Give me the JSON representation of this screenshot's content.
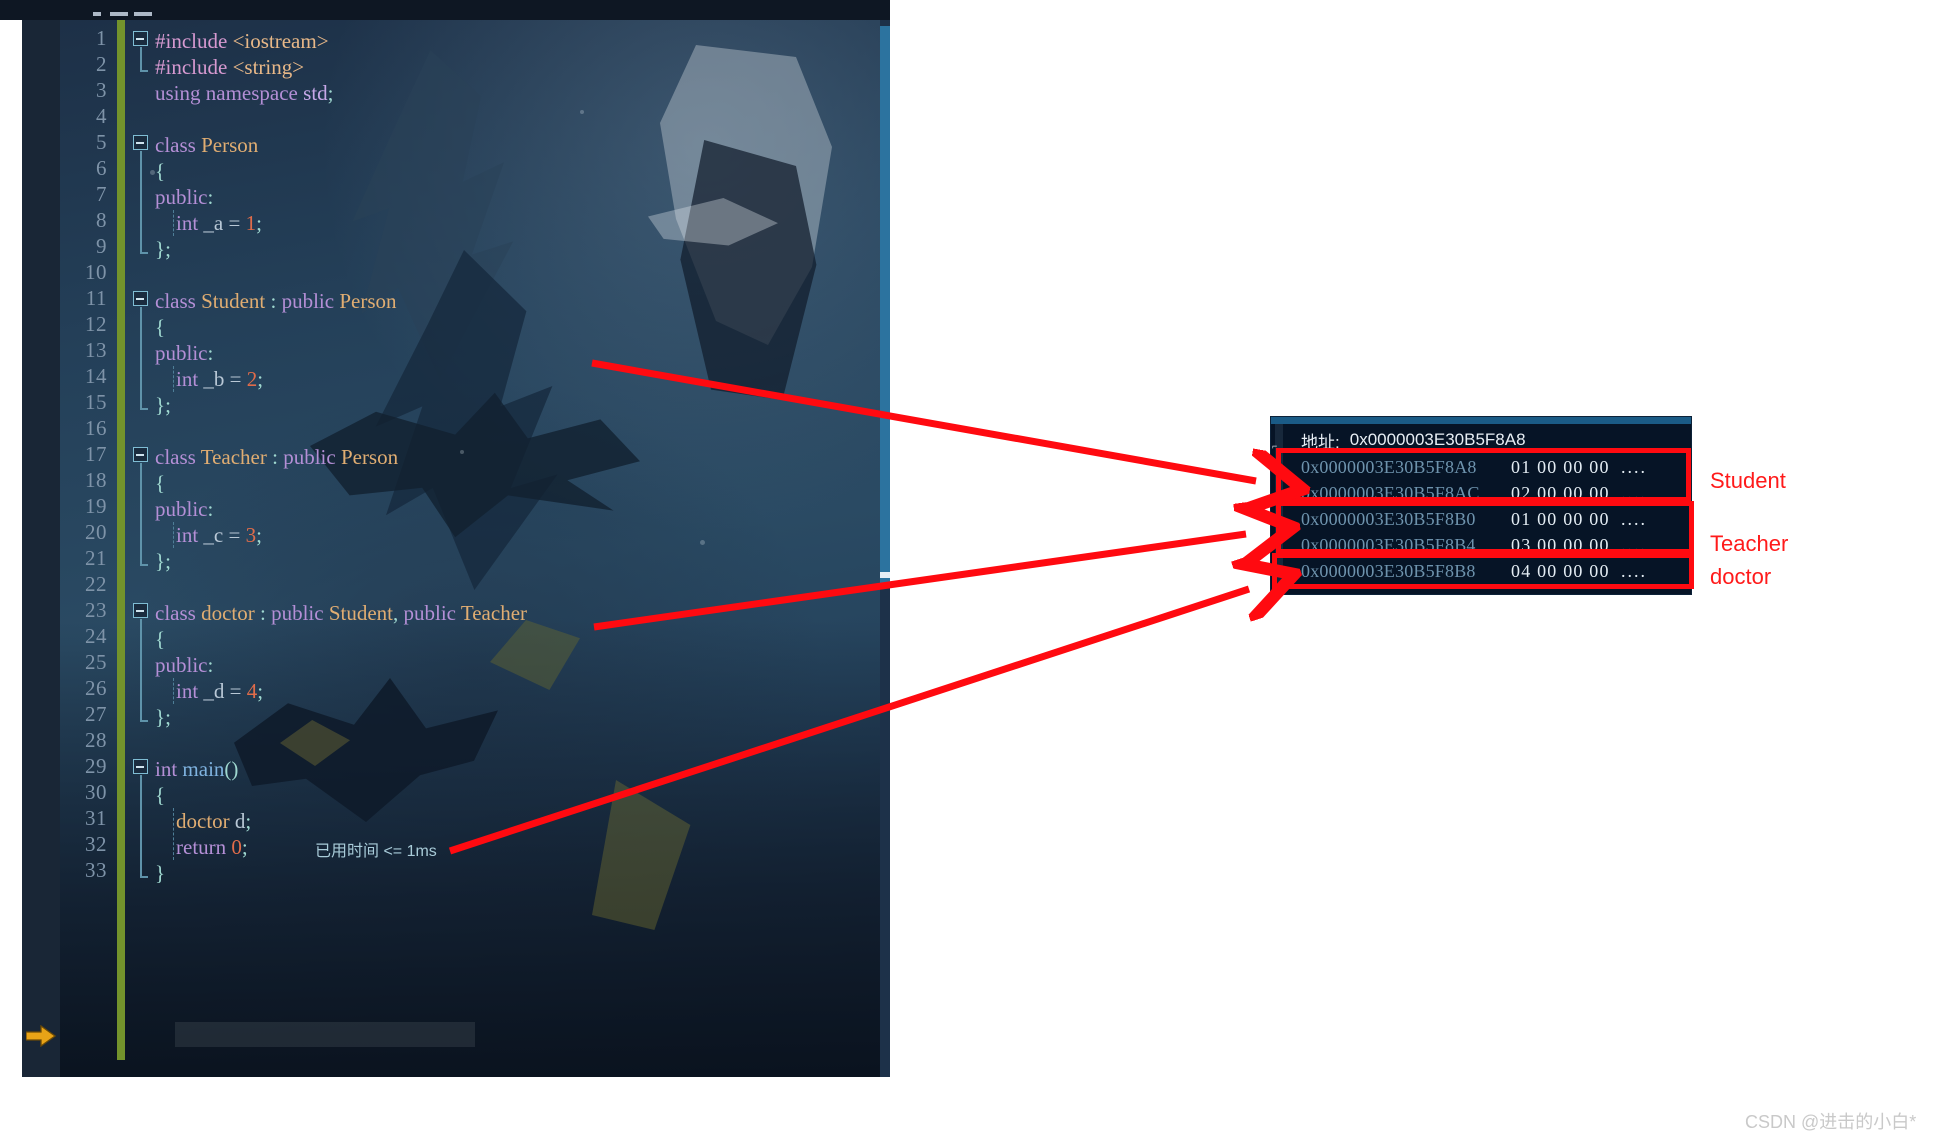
{
  "editor": {
    "changes_bar_color": "#73932c",
    "lines": [
      {
        "n": "1",
        "text": "#include <iostream>"
      },
      {
        "n": "2",
        "text": "#include <string>"
      },
      {
        "n": "3",
        "text": "using namespace std;"
      },
      {
        "n": "4",
        "text": ""
      },
      {
        "n": "5",
        "text": "class Person"
      },
      {
        "n": "6",
        "text": "{"
      },
      {
        "n": "7",
        "text": "public:"
      },
      {
        "n": "8",
        "text": "    int _a = 1;"
      },
      {
        "n": "9",
        "text": "};"
      },
      {
        "n": "10",
        "text": ""
      },
      {
        "n": "11",
        "text": "class Student : public Person"
      },
      {
        "n": "12",
        "text": "{"
      },
      {
        "n": "13",
        "text": "public:"
      },
      {
        "n": "14",
        "text": "    int _b = 2;"
      },
      {
        "n": "15",
        "text": "};"
      },
      {
        "n": "16",
        "text": ""
      },
      {
        "n": "17",
        "text": "class Teacher : public Person"
      },
      {
        "n": "18",
        "text": "{"
      },
      {
        "n": "19",
        "text": "public:"
      },
      {
        "n": "20",
        "text": "    int _c = 3;"
      },
      {
        "n": "21",
        "text": "};"
      },
      {
        "n": "22",
        "text": ""
      },
      {
        "n": "23",
        "text": "class doctor : public Student, public Teacher"
      },
      {
        "n": "24",
        "text": "{"
      },
      {
        "n": "25",
        "text": "public:"
      },
      {
        "n": "26",
        "text": "    int _d = 4;"
      },
      {
        "n": "27",
        "text": "};"
      },
      {
        "n": "28",
        "text": ""
      },
      {
        "n": "29",
        "text": "int main()"
      },
      {
        "n": "30",
        "text": "{"
      },
      {
        "n": "31",
        "text": "    doctor d;"
      },
      {
        "n": "32",
        "text": "    return 0;"
      },
      {
        "n": "33",
        "text": "}"
      }
    ],
    "diagnostic_label": "已用时间 <= 1ms"
  },
  "memory_window": {
    "address_label": "地址:",
    "address_value": "0x0000003E30B5F8A8",
    "rows": [
      {
        "address": "0x0000003E30B5F8A8",
        "bytes": "01 00 00 00",
        "ascii": "...."
      },
      {
        "address": "0x0000003E30B5F8AC",
        "bytes": "02 00 00 00",
        "ascii": "...."
      },
      {
        "address": "0x0000003E30B5F8B0",
        "bytes": "01 00 00 00",
        "ascii": "...."
      },
      {
        "address": "0x0000003E30B5F8B4",
        "bytes": "03 00 00 00",
        "ascii": "...."
      },
      {
        "address": "0x0000003E30B5F8B8",
        "bytes": "04 00 00 00",
        "ascii": "...."
      }
    ]
  },
  "annotations": {
    "highlight_color": "#ff0a10",
    "label_student": "Student",
    "label_teacher": "Teacher",
    "label_doctor": "doctor"
  },
  "watermark": "CSDN @进击的小白*"
}
